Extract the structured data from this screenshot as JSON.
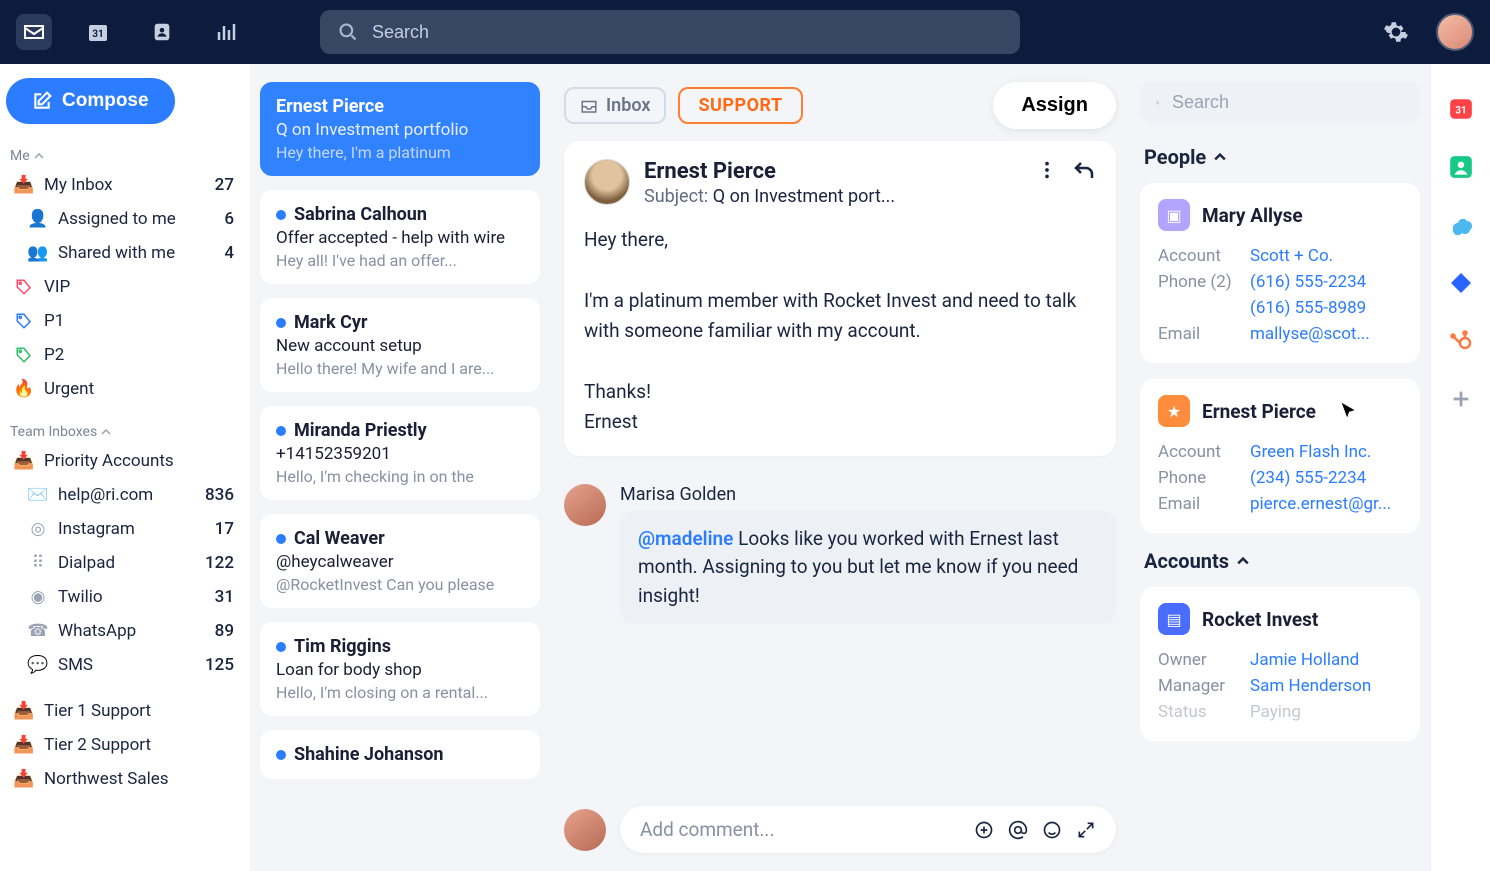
{
  "topnav": {
    "search_placeholder": "Search"
  },
  "compose_label": "Compose",
  "side_me": {
    "label": "Me",
    "inbox": {
      "label": "My Inbox",
      "count": "27"
    },
    "assigned": {
      "label": "Assigned to me",
      "count": "6"
    },
    "shared": {
      "label": "Shared with me",
      "count": "4"
    }
  },
  "tags": {
    "vip": "VIP",
    "p1": "P1",
    "p2": "P2",
    "urgent": "Urgent"
  },
  "team": {
    "label": "Team Inboxes",
    "priority": "Priority Accounts",
    "items": [
      {
        "label": "help@ri.com",
        "count": "836"
      },
      {
        "label": "Instagram",
        "count": "17"
      },
      {
        "label": "Dialpad",
        "count": "122"
      },
      {
        "label": "Twilio",
        "count": "31"
      },
      {
        "label": "WhatsApp",
        "count": "89"
      },
      {
        "label": "SMS",
        "count": "125"
      }
    ],
    "tier1": "Tier 1 Support",
    "tier2": "Tier 2 Support",
    "nw": "Northwest Sales"
  },
  "conversations": [
    {
      "name": "Ernest Pierce",
      "subj": "Q on Investment portfolio",
      "preview": "Hey there, I'm a platinum"
    },
    {
      "name": "Sabrina Calhoun",
      "subj": "Offer accepted - help with wire",
      "preview": "Hey all! I've had an offer..."
    },
    {
      "name": "Mark Cyr",
      "subj": "New account setup",
      "preview": "Hello there! My wife and I are..."
    },
    {
      "name": "Miranda Priestly",
      "subj": "+14152359201",
      "preview": "Hello, I'm checking in on the"
    },
    {
      "name": "Cal Weaver",
      "subj": "@heycalweaver",
      "preview": "@RocketInvest Can you please"
    },
    {
      "name": "Tim Riggins",
      "subj": "Loan for body shop",
      "preview": "Hello, I'm closing on a rental..."
    },
    {
      "name": "Shahine Johanson",
      "subj": "",
      "preview": ""
    }
  ],
  "thread": {
    "inbox_label": "Inbox",
    "support_label": "SUPPORT",
    "assign_label": "Assign",
    "sender": "Ernest Pierce",
    "subject_prefix": "Subject:",
    "subject": "Q on Investment port...",
    "body": "Hey there,\n\nI'm a platinum member with Rocket Invest and need to talk with someone familiar with my account.\n\nThanks!\nErnest",
    "comment_author": "Marisa Golden",
    "mention": "@madeline",
    "comment_text": "Looks like you worked with Ernest last month. Assigning to you but let me know if you need insight!",
    "comment_placeholder": "Add comment..."
  },
  "right": {
    "search_placeholder": "Search",
    "people_label": "People",
    "people": [
      {
        "name": "Mary Allyse",
        "icon_bg": "#b3a4ff",
        "rows": [
          {
            "label": "Account",
            "val": "Scott + Co."
          },
          {
            "label": "Phone (2)",
            "val": "(616) 555-2234"
          },
          {
            "label": "",
            "val": "(616) 555-8989"
          },
          {
            "label": "Email",
            "val": "mallyse@scot..."
          }
        ]
      },
      {
        "name": "Ernest Pierce",
        "icon_bg": "#ff8b3d",
        "rows": [
          {
            "label": "Account",
            "val": "Green Flash Inc."
          },
          {
            "label": "Phone",
            "val": "(234) 555-2234"
          },
          {
            "label": "Email",
            "val": "pierce.ernest@gr..."
          }
        ]
      }
    ],
    "accounts_label": "Accounts",
    "accounts": [
      {
        "name": "Rocket Invest",
        "icon_bg": "#4a6dff",
        "rows": [
          {
            "label": "Owner",
            "val": "Jamie Holland"
          },
          {
            "label": "Manager",
            "val": "Sam Henderson"
          },
          {
            "label": "Status",
            "val": "Paying"
          }
        ]
      }
    ]
  }
}
